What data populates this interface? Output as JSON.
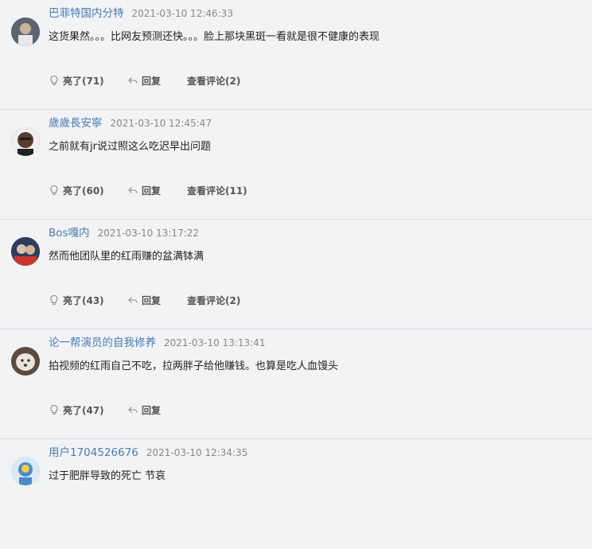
{
  "comments": [
    {
      "username": "巴菲特国内分特",
      "time": "2021-03-10 12:46:33",
      "content": "这货果然。。。比网友预测还快。。。脸上那块黑斑一看就是很不健康的表现",
      "like_label": "亮了(71)",
      "reply_label": "回复",
      "view_label": "查看评论(2)",
      "avatar_color": "#6d7480"
    },
    {
      "username": "歲歲長安寧",
      "time": "2021-03-10 12:45:47",
      "content": "之前就有jr说过照这么吃迟早出问题",
      "like_label": "亮了(60)",
      "reply_label": "回复",
      "view_label": "查看评论(11)",
      "avatar_color": "#8b5a3c"
    },
    {
      "username": "Bos嘎内",
      "time": "2021-03-10 13:17:22",
      "content": "然而他团队里的红雨赚的盆满钵满",
      "like_label": "亮了(43)",
      "reply_label": "回复",
      "view_label": "查看评论(2)",
      "avatar_color": "#3b4a6b"
    },
    {
      "username": "论一帮演员的自我修养",
      "time": "2021-03-10 13:13:41",
      "content": "拍视频的红雨自己不吃，拉两胖子给他赚钱。也算是吃人血馒头",
      "like_label": "亮了(47)",
      "reply_label": "回复",
      "view_label": "",
      "avatar_color": "#b9a58f"
    },
    {
      "username": "用户1704526676",
      "time": "2021-03-10 12:34:35",
      "content": "过于肥胖导致的死亡 节哀",
      "like_label": "",
      "reply_label": "",
      "view_label": "",
      "avatar_color": "#6aa6d6"
    }
  ],
  "icons": {
    "like": "lightbulb-icon",
    "reply": "reply-arrow-icon"
  },
  "colors": {
    "username": "#4a7cb1",
    "background": "#f2f3f5",
    "divider": "#dcdde0"
  }
}
